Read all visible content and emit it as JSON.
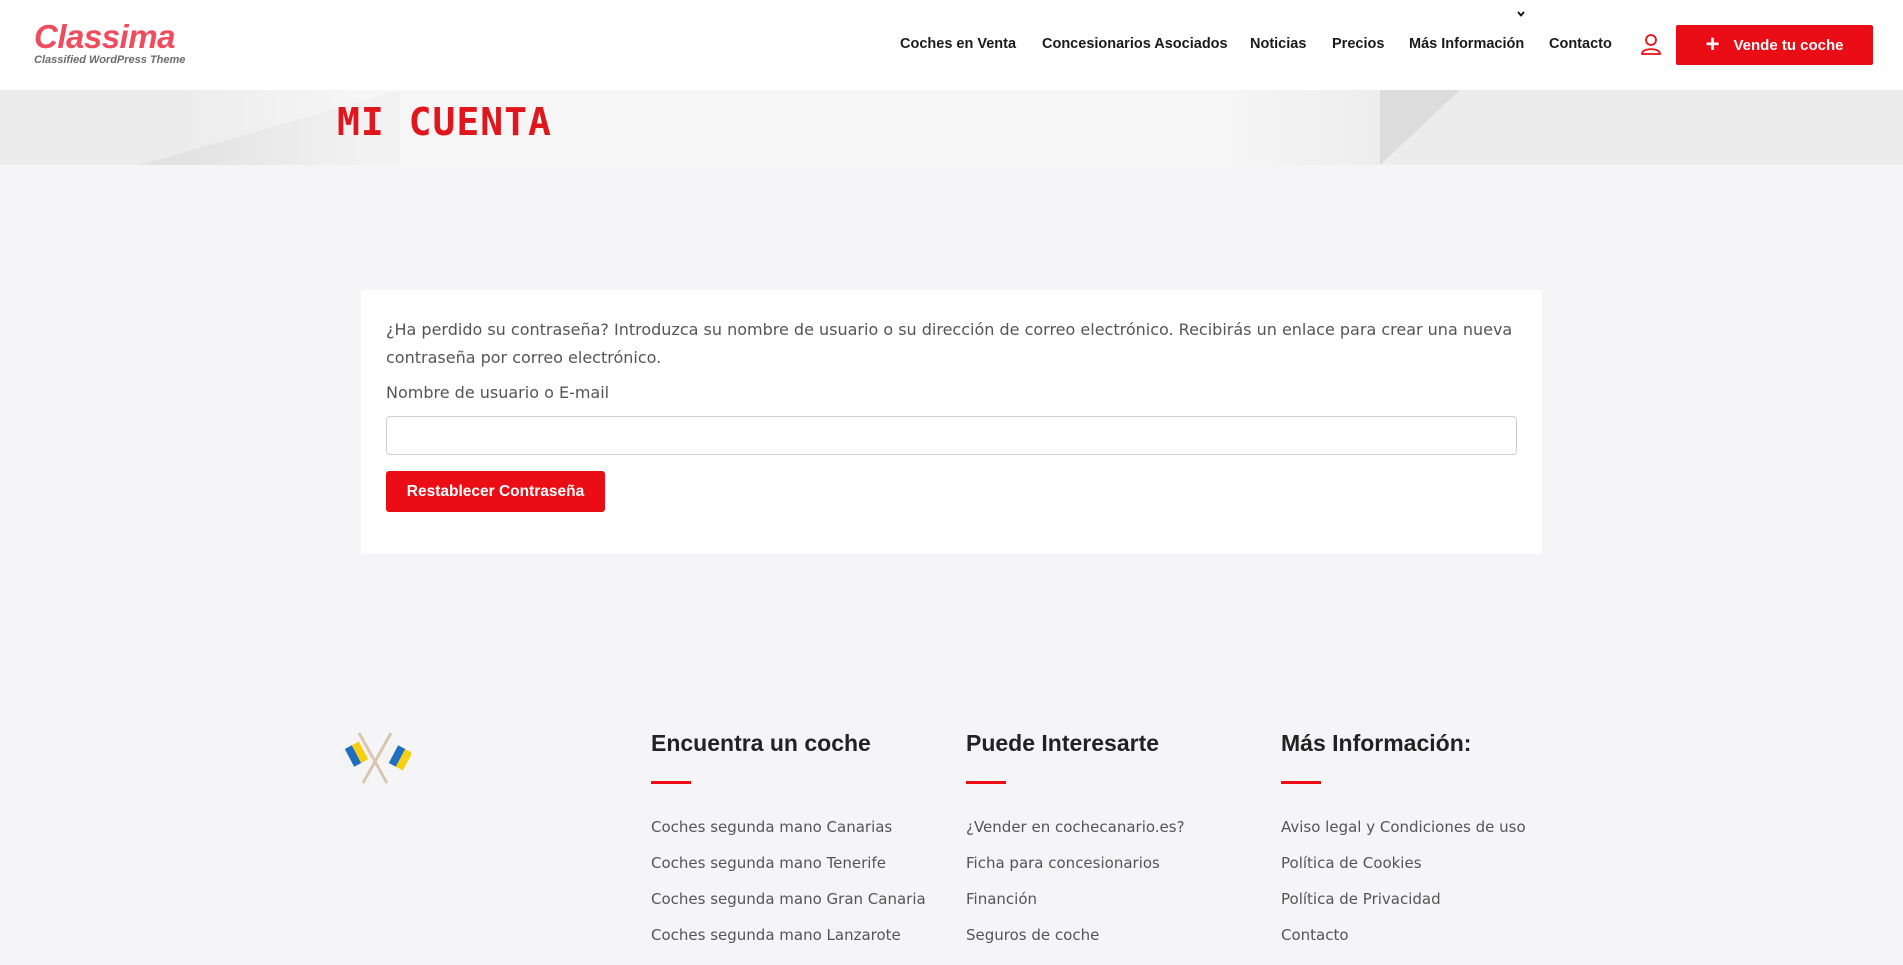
{
  "header": {
    "logo_main": "Classima",
    "logo_sub": "Classified WordPress Theme",
    "nav": [
      {
        "label": "Coches en Venta"
      },
      {
        "label": "Concesionarios Asociados"
      },
      {
        "label": "Noticias"
      },
      {
        "label": "Precios"
      },
      {
        "label": "Más Información"
      },
      {
        "label": "Contacto"
      }
    ],
    "sell_button": "Vende tu coche"
  },
  "banner": {
    "title": "MI CUENTA"
  },
  "form": {
    "instructions": "¿Ha perdido su contraseña? Introduzca su nombre de usuario o su dirección de correo electrónico. Recibirás un enlace para crear una nueva contraseña por correo electrónico.",
    "field_label": "Nombre de usuario o E-mail",
    "field_value": "",
    "submit_label": "Restablecer Contraseña"
  },
  "footer": {
    "columns": [
      {
        "title": "Encuentra un coche",
        "links": [
          "Coches segunda mano Canarias",
          "Coches segunda mano Tenerife",
          "Coches segunda mano Gran Canaria",
          "Coches segunda mano Lanzarote"
        ]
      },
      {
        "title": "Puede Interesarte",
        "links": [
          "¿Vender en cochecanario.es?",
          "Ficha para concesionarios",
          "Financión",
          "Seguros de coche"
        ]
      },
      {
        "title": "Más Información:",
        "links": [
          "Aviso legal y Condiciones de uso",
          "Política de Cookies",
          "Política de Privacidad",
          "Contacto"
        ]
      }
    ]
  },
  "colors": {
    "brand_red": "#ea0d15",
    "logo_pink": "#ef4d5d"
  }
}
